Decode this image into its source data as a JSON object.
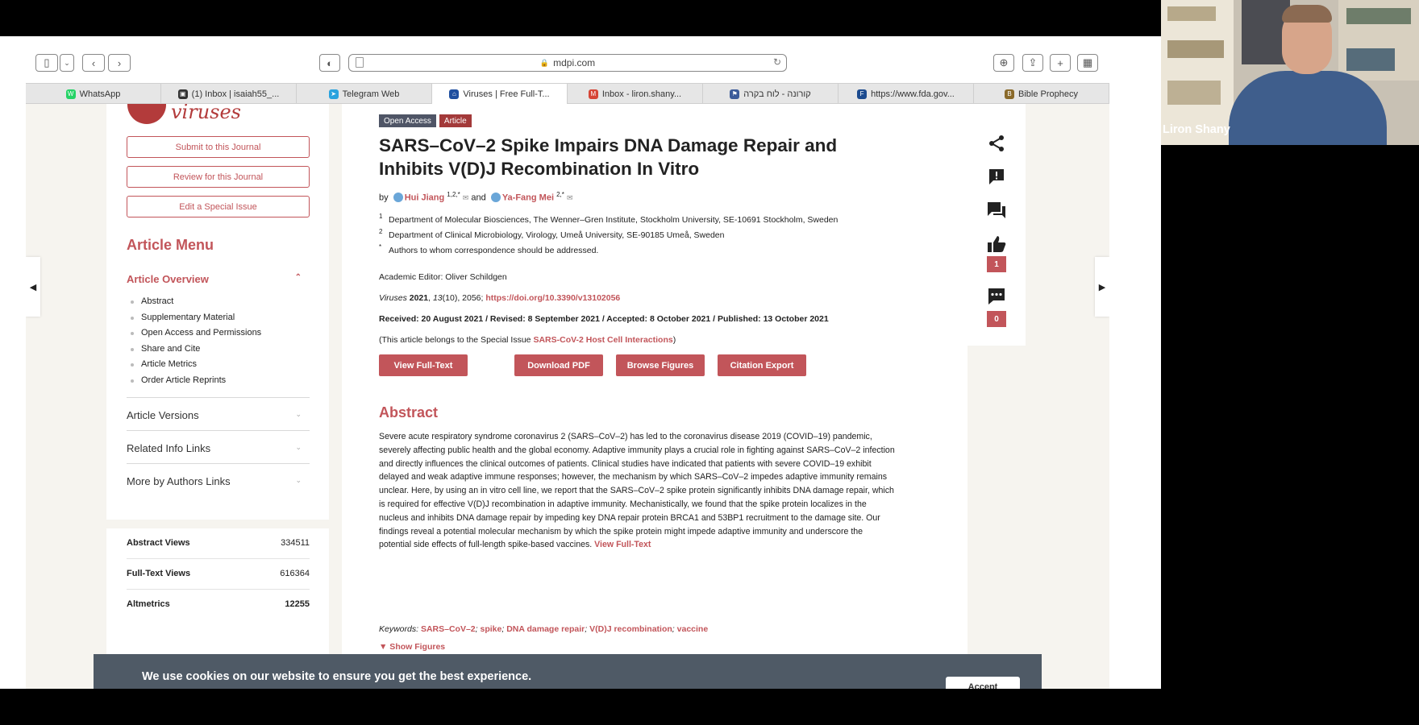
{
  "browser": {
    "url": "mdpi.com",
    "tabs": [
      {
        "label": "WhatsApp",
        "fav_color": "#25d366",
        "fav": "W",
        "active": false
      },
      {
        "label": "(1) Inbox | isaiah55_...",
        "fav_color": "#333333",
        "fav": "▣",
        "active": false
      },
      {
        "label": "Telegram Web",
        "fav_color": "#2aa3de",
        "fav": "➤",
        "active": false
      },
      {
        "label": "Viruses | Free Full-T...",
        "fav_color": "#1f4fa0",
        "fav": "⌂",
        "active": true
      },
      {
        "label": "Inbox - liron.shany...",
        "fav_color": "#d64536",
        "fav": "M",
        "active": false
      },
      {
        "label": "קורונה - לוח בקרה",
        "fav_color": "#3b5b9a",
        "fav": "⚑",
        "active": false
      },
      {
        "label": "https://www.fda.gov...",
        "fav_color": "#1c4b8f",
        "fav": "F",
        "active": false
      },
      {
        "label": "Bible Prophecy",
        "fav_color": "#8a6a2a",
        "fav": "B",
        "active": false
      }
    ]
  },
  "left": {
    "logo_text": "viruses",
    "buttons": [
      "Submit to this Journal",
      "Review for this Journal",
      "Edit a Special Issue"
    ],
    "menu_title": "Article Menu",
    "overview_title": "Article Overview",
    "overview_items": [
      "Abstract",
      "Supplementary Material",
      "Open Access and Permissions",
      "Share and Cite",
      "Article Metrics",
      "Order Article Reprints"
    ],
    "collapsibles": [
      "Article Versions",
      "Related Info Links",
      "More by Authors Links"
    ],
    "metrics": [
      {
        "label": "Abstract Views",
        "value": "334511"
      },
      {
        "label": "Full-Text Views",
        "value": "616364"
      },
      {
        "label": "Altmetrics",
        "value": "12255"
      }
    ]
  },
  "article": {
    "badge_open": "Open Access",
    "badge_type": "Article",
    "title": "SARS–CoV–2 Spike Impairs DNA Damage Repair and Inhibits V(D)J Recombination In Vitro",
    "by": "by",
    "author1": "Hui Jiang",
    "author1_sup": "1,2,*",
    "and": "and",
    "author2": "Ya-Fang Mei",
    "author2_sup": "2,*",
    "affil1_num": "1",
    "affil1": "Department of Molecular Biosciences, The Wenner–Gren Institute, Stockholm University, SE-10691 Stockholm, Sweden",
    "affil2_num": "2",
    "affil2": "Department of Clinical Microbiology, Virology, Umeå University, SE-90185 Umeå, Sweden",
    "affil3_num": "*",
    "affil3": "Authors to whom correspondence should be addressed.",
    "editor": "Academic Editor: Oliver Schildgen",
    "journal": "Viruses",
    "year": "2021",
    "volume": "13",
    "issue_pages": "(10), 2056;",
    "doi": "https://doi.org/10.3390/v13102056",
    "dates": "Received: 20 August 2021 / Revised: 8 September 2021 / Accepted: 8 October 2021 / Published: 13 October 2021",
    "special_prefix": "(This article belongs to the Special Issue",
    "special_link": "SARS-CoV-2 Host Cell Interactions",
    "special_suffix": ")",
    "actions": [
      "View Full-Text",
      "Download PDF",
      "Browse Figures",
      "Citation Export"
    ],
    "abstract_title": "Abstract",
    "abstract": "Severe acute respiratory syndrome coronavirus 2 (SARS–CoV–2) has led to the coronavirus disease 2019 (COVID–19) pandemic, severely affecting public health and the global economy. Adaptive immunity plays a crucial role in fighting against SARS–CoV–2 infection and directly influences the clinical outcomes of patients. Clinical studies have indicated that patients with severe COVID–19 exhibit delayed and weak adaptive immune responses; however, the mechanism by which SARS–CoV–2 impedes adaptive immunity remains unclear. Here, by using an in vitro cell line, we report that the SARS–CoV–2 spike protein significantly inhibits DNA damage repair, which is required for effective V(D)J recombination in adaptive immunity. Mechanistically, we found that the spike protein localizes in the nucleus and inhibits DNA damage repair by impeding key DNA repair protein BRCA1 and 53BP1 recruitment to the damage site. Our findings reveal a potential molecular mechanism by which the spike protein might impede adaptive immunity and underscore the potential side effects of full-length spike-based vaccines.",
    "abstract_link": "View Full-Text",
    "keywords_label": "Keywords:",
    "keywords": [
      "SARS–CoV–2",
      "spike",
      "DNA damage repair",
      "V(D)J recombination",
      "vaccine"
    ],
    "show_figures": "▼ Show Figures"
  },
  "rail": {
    "likes": "1",
    "comments": "0"
  },
  "cookie": {
    "text": "We use cookies on our website to ensure you get the best experience.",
    "accept": "Accept"
  },
  "webcam": {
    "name": "Liron Shany"
  },
  "colors": {
    "accent": "#c2555a",
    "badge_open": "#4f5566",
    "badge_type": "#a33a3a"
  }
}
